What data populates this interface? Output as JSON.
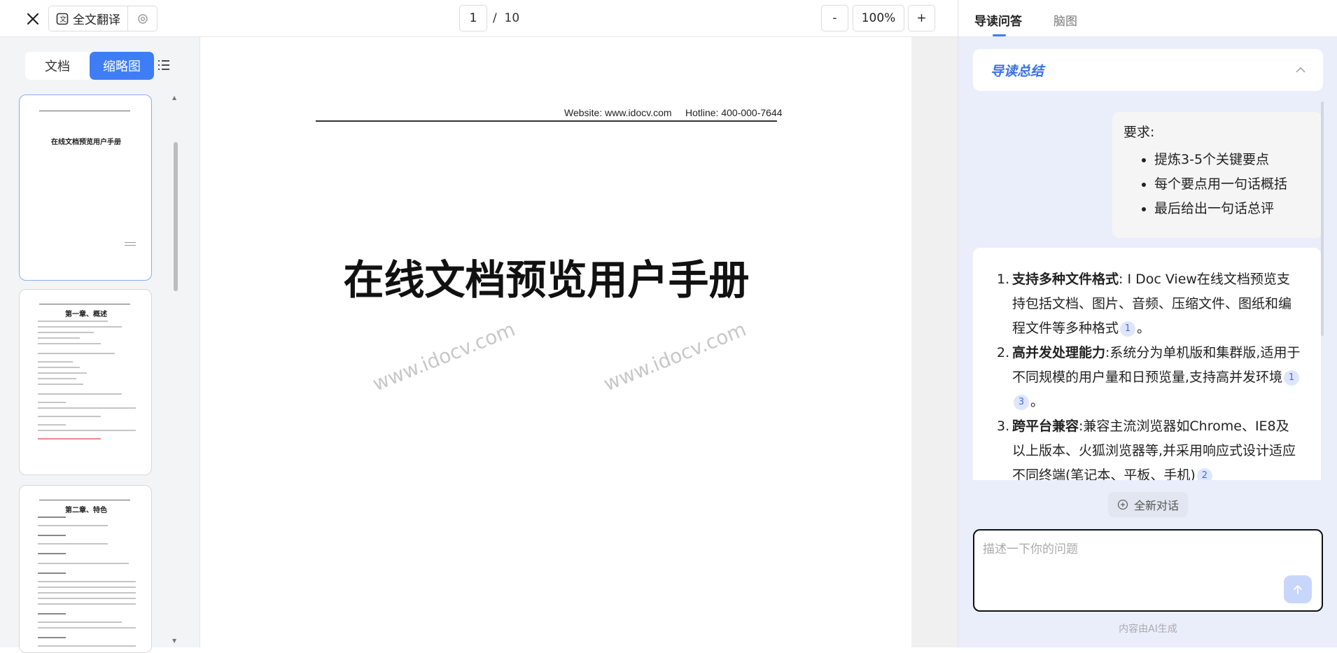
{
  "toolbar": {
    "translate_label": "全文翻译",
    "page_current": "1",
    "page_sep": "/",
    "page_total": "10",
    "zoom_minus": "-",
    "zoom_level": "100%",
    "zoom_plus": "+"
  },
  "sidebar": {
    "tabs": [
      "文档",
      "缩略图"
    ],
    "active_tab": "缩略图",
    "thumbnails": [
      {
        "title": "在线文档预览用户手册"
      },
      {
        "title": "第一章、概述"
      },
      {
        "title": "第二章、特色"
      }
    ]
  },
  "document": {
    "header_text": "Website: www.idocv.com     Hotline: 400-000-7644",
    "title": "在线文档预览用户手册",
    "watermark": "www.idocv.com"
  },
  "right_panel": {
    "tabs": [
      "导读问答",
      "脑图"
    ],
    "active_tab": "导读问答",
    "summary_title": "导读总结",
    "prompt": {
      "heading": "要求:",
      "items": [
        "提炼3-5个关键要点",
        "每个要点用一句话概括",
        "最后给出一句话总评"
      ]
    },
    "answer": [
      {
        "num": "1.",
        "title": "支持多种文件格式",
        "text": ": I Doc View在线文档预览支持包括文档、图片、音频、压缩文件、图纸和编程文件等多种格式",
        "cites": [
          "1"
        ],
        "end": "。"
      },
      {
        "num": "2.",
        "title": "高并发处理能力",
        "text": ":系统分为单机版和集群版,适用于不同规模的用户量和日预览量,支持高并发环境",
        "cites": [
          "1",
          "3"
        ],
        "end": "。"
      },
      {
        "num": "3.",
        "title": "跨平台兼容",
        "text": ":兼容主流浏览器如Chrome、IE8及以上版本、火狐浏览器等,并采用响应式设计适应不同终端(笔记本、平板、手机)",
        "cites": [
          "2"
        ],
        "end": ""
      }
    ],
    "new_chat_label": "全新对话",
    "input_placeholder": "描述一下你的问题",
    "ai_note": "内容由AI生成"
  },
  "colors": {
    "accent": "#3f7df7",
    "panel_bg": "#eaeefb",
    "summary_title": "#3a6fe8"
  }
}
